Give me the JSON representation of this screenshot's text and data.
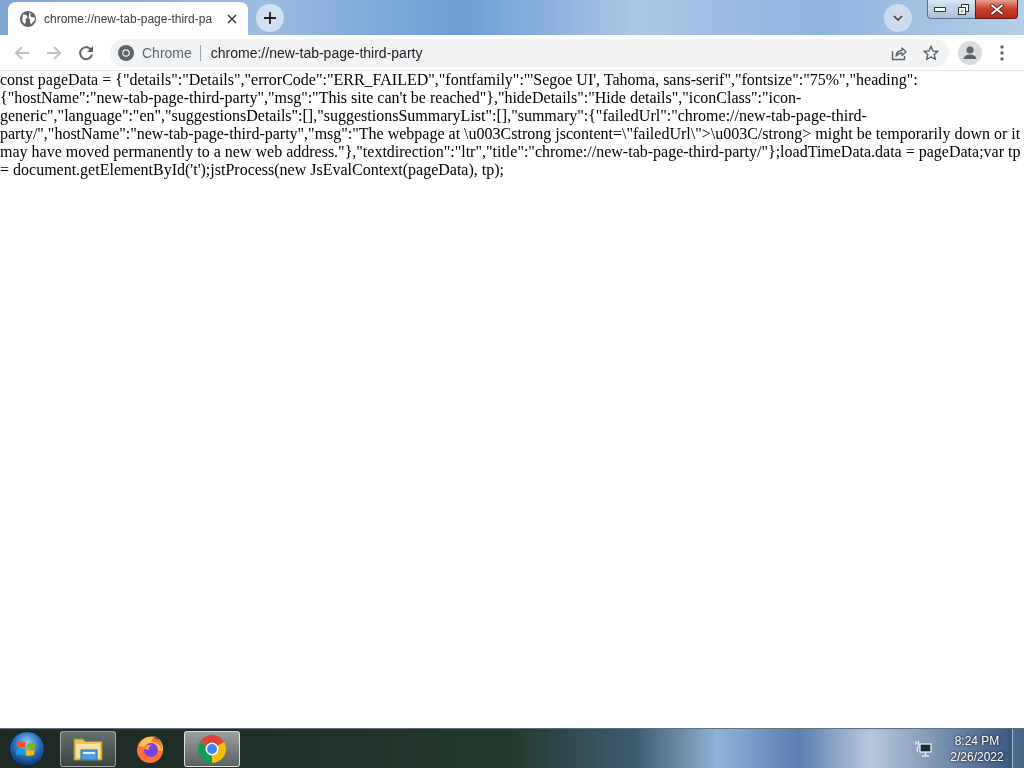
{
  "browser": {
    "tabs": [
      {
        "title": "chrome://new-tab-page-third-pa",
        "selected": true
      }
    ],
    "nav_buttons": [
      {
        "kind": "back",
        "disabled": true
      },
      {
        "kind": "forward",
        "disabled": true
      },
      {
        "kind": "reload",
        "disabled": false
      }
    ],
    "omnibox": {
      "chip": "Chrome",
      "url": "chrome://new-tab-page-third-party"
    }
  },
  "page": {
    "text": "const pageData = {\"details\":\"Details\",\"errorCode\":\"ERR_FAILED\",\"fontfamily\":\"'Segoe UI', Tahoma, sans-serif\",\"fontsize\":\"75%\",\"heading\":{\"hostName\":\"new-tab-page-third-party\",\"msg\":\"This site can't be reached\"},\"hideDetails\":\"Hide details\",\"iconClass\":\"icon-generic\",\"language\":\"en\",\"suggestionsDetails\":[],\"suggestionsSummaryList\":[],\"summary\":{\"failedUrl\":\"chrome://new-tab-page-third-party/\",\"hostName\":\"new-tab-page-third-party\",\"msg\":\"The webpage at \\u003Cstrong jscontent=\\\"failedUrl\\\">\\u003C/strong> might be temporarily down or it may have moved permanently to a new web address.\"},\"textdirection\":\"ltr\",\"title\":\"chrome://new-tab-page-third-party/\"};loadTimeData.data = pageData;var tp = document.getElementById('t');jstProcess(new JsEvalContext(pageData), tp);"
  },
  "taskbar": {
    "apps": [
      {
        "kind": "folder",
        "running": true,
        "selected": false
      },
      {
        "kind": "firefox",
        "running": false,
        "selected": false
      },
      {
        "kind": "chrome",
        "running": true,
        "selected": true
      }
    ],
    "clock": {
      "time": "8:24 PM",
      "date": "2/26/2022"
    }
  }
}
